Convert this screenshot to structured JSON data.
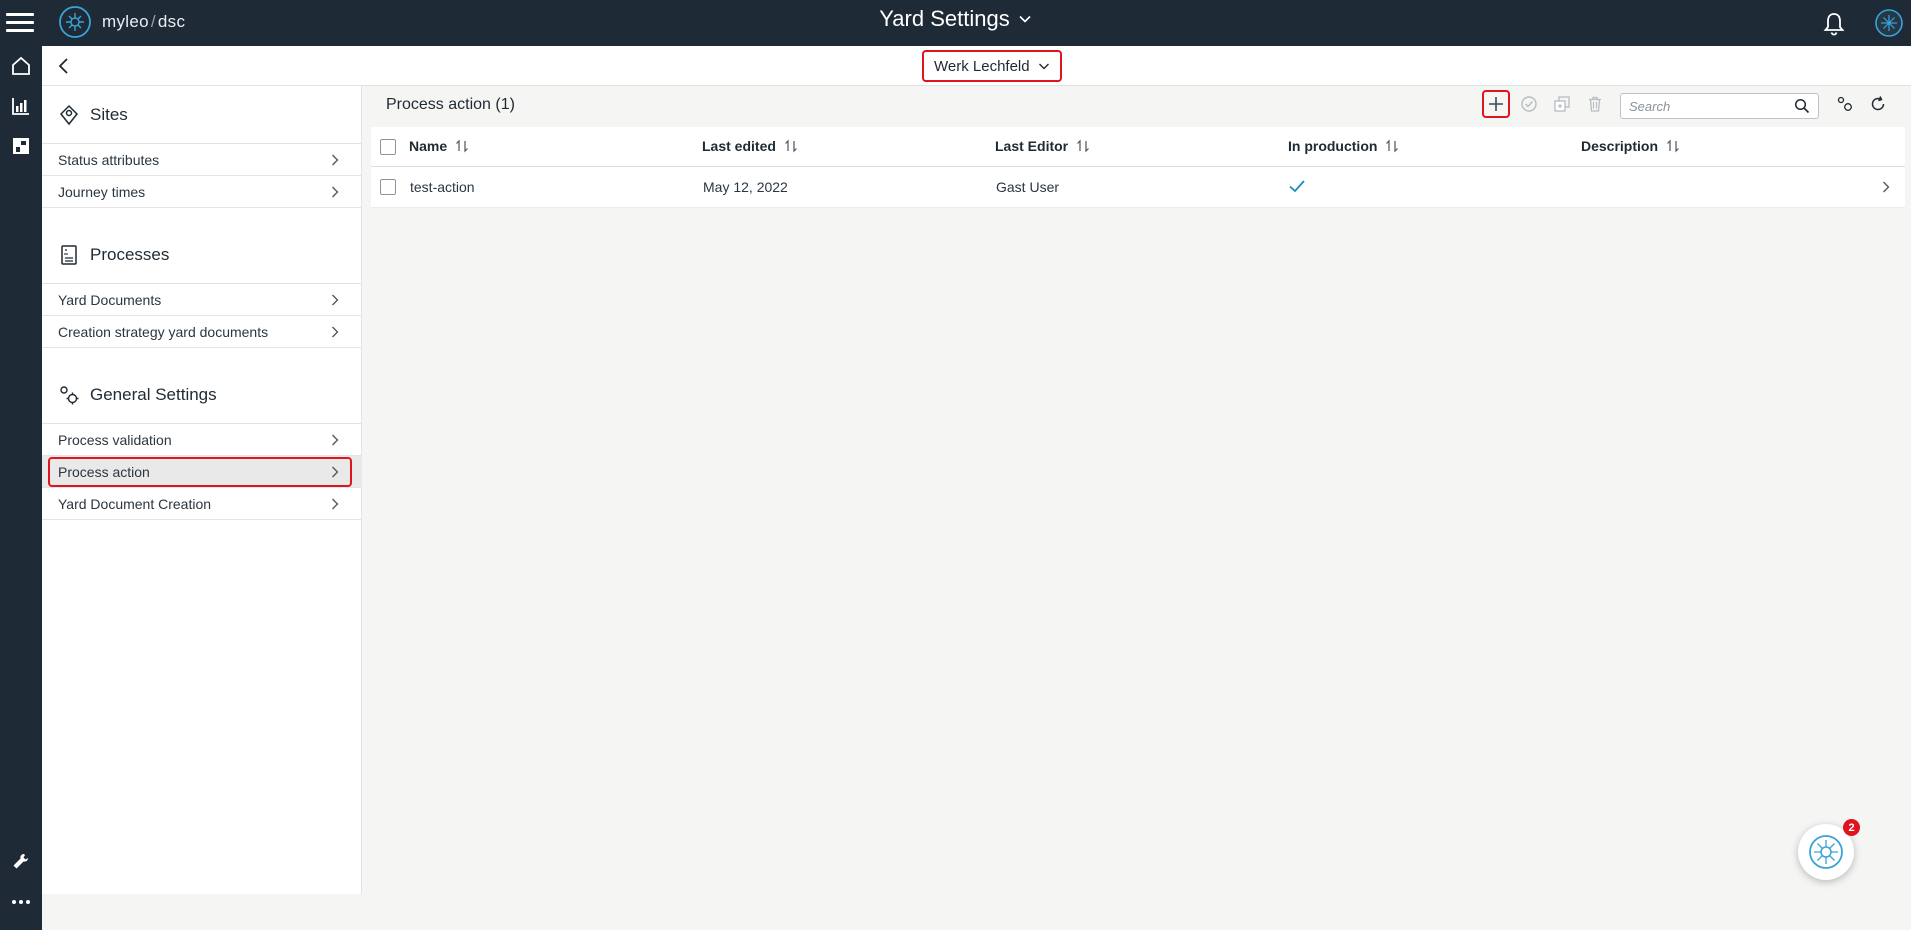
{
  "app": {
    "brand": "myleo",
    "brand_separator": "/",
    "brand_product": "dsc",
    "page_title": "Yard Settings"
  },
  "subheader": {
    "site_selector": "Werk Lechfeld"
  },
  "sidebar": {
    "sections": [
      {
        "title": "Sites",
        "icon": "location-pin-icon",
        "items": [
          {
            "label": "Status attributes"
          },
          {
            "label": "Journey times"
          }
        ]
      },
      {
        "title": "Processes",
        "icon": "document-icon",
        "items": [
          {
            "label": "Yard Documents"
          },
          {
            "label": "Creation strategy yard documents"
          }
        ]
      },
      {
        "title": "General Settings",
        "icon": "settings-icon",
        "items": [
          {
            "label": "Process validation"
          },
          {
            "label": "Process action",
            "active": true
          },
          {
            "label": "Yard Document Creation"
          }
        ]
      }
    ]
  },
  "main": {
    "title": "Process action (1)",
    "search_placeholder": "Search",
    "columns": [
      "Name",
      "Last edited",
      "Last Editor",
      "In production",
      "Description"
    ],
    "rows": [
      {
        "name": "test-action",
        "last_edited": "May 12, 2022",
        "last_editor": "Gast User",
        "in_production": true,
        "description": ""
      }
    ]
  },
  "assistant": {
    "badge_count": "2"
  },
  "colors": {
    "topbar": "#1e2a35",
    "highlight": "#e0141e",
    "accent": "#1f8ac0"
  }
}
